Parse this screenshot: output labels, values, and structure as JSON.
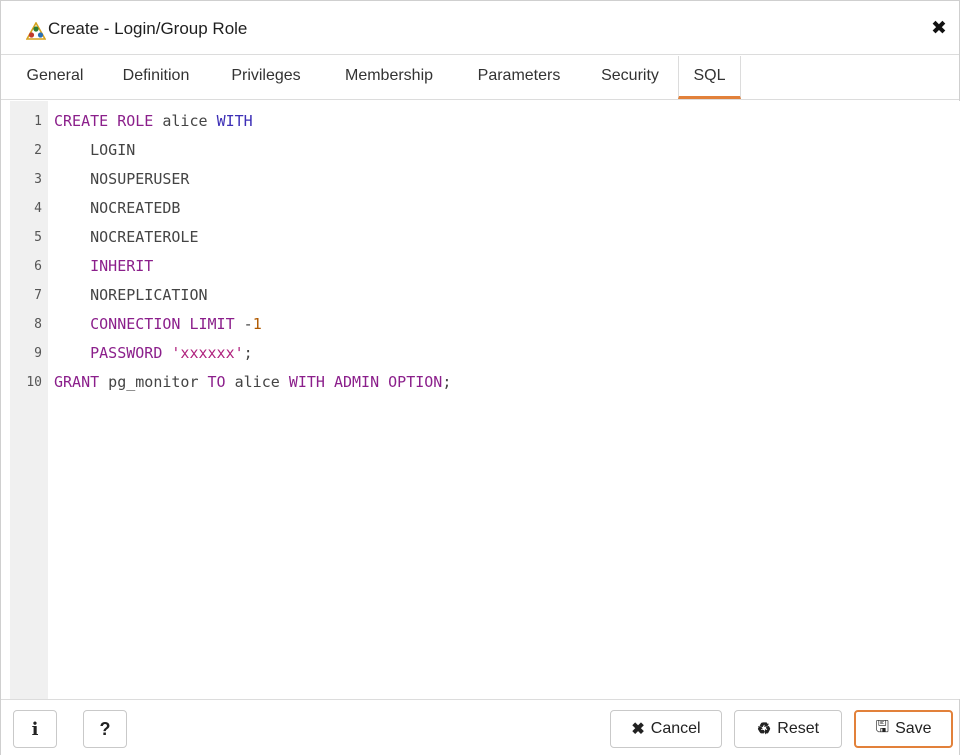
{
  "dialog": {
    "title": "Create - Login/Group Role",
    "close_glyph": "✖"
  },
  "tabs": [
    {
      "label": "General"
    },
    {
      "label": "Definition"
    },
    {
      "label": "Privileges"
    },
    {
      "label": "Membership"
    },
    {
      "label": "Parameters"
    },
    {
      "label": "Security"
    },
    {
      "label": "SQL",
      "active": true
    }
  ],
  "editor": {
    "line_numbers": [
      "1",
      "2",
      "3",
      "4",
      "5",
      "6",
      "7",
      "8",
      "9",
      "10"
    ],
    "lines": [
      [
        {
          "t": "CREATE ROLE",
          "c": "kw"
        },
        {
          "t": " alice ",
          "c": "ident"
        },
        {
          "t": "WITH",
          "c": "kw2"
        }
      ],
      [
        {
          "t": "    LOGIN",
          "c": "ident"
        }
      ],
      [
        {
          "t": "    NOSUPERUSER",
          "c": "ident"
        }
      ],
      [
        {
          "t": "    NOCREATEDB",
          "c": "ident"
        }
      ],
      [
        {
          "t": "    NOCREATEROLE",
          "c": "ident"
        }
      ],
      [
        {
          "t": "    ",
          "c": "ident"
        },
        {
          "t": "INHERIT",
          "c": "kw"
        }
      ],
      [
        {
          "t": "    NOREPLICATION",
          "c": "ident"
        }
      ],
      [
        {
          "t": "    ",
          "c": "ident"
        },
        {
          "t": "CONNECTION LIMIT",
          "c": "kw"
        },
        {
          "t": " -",
          "c": "ident"
        },
        {
          "t": "1",
          "c": "num"
        }
      ],
      [
        {
          "t": "    ",
          "c": "ident"
        },
        {
          "t": "PASSWORD",
          "c": "kw"
        },
        {
          "t": " ",
          "c": "ident"
        },
        {
          "t": "'xxxxxx'",
          "c": "str"
        },
        {
          "t": ";",
          "c": "ident"
        }
      ],
      [
        {
          "t": "GRANT",
          "c": "kw"
        },
        {
          "t": " pg_monitor ",
          "c": "ident"
        },
        {
          "t": "TO",
          "c": "kw"
        },
        {
          "t": " alice ",
          "c": "ident"
        },
        {
          "t": "WITH ADMIN OPTION",
          "c": "kw"
        },
        {
          "t": ";",
          "c": "ident"
        }
      ]
    ]
  },
  "footer": {
    "info_glyph": "i",
    "help_glyph": "?",
    "cancel_label": "Cancel",
    "cancel_glyph": "✖",
    "reset_label": "Reset",
    "reset_glyph": "♻",
    "save_label": "Save",
    "save_glyph": "🖫"
  },
  "colors": {
    "accent": "#e2813a",
    "keyword": "#8b1f8b",
    "keyword_alt": "#3d2fb6",
    "string": "#b0227e",
    "number": "#b05a00"
  }
}
